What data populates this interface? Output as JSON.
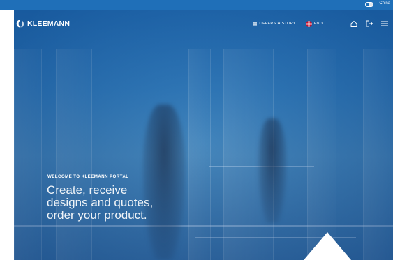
{
  "topbar": {
    "region_label": "China"
  },
  "header": {
    "brand": "KLEEMANN",
    "offers_history": "OFFERS HISTORY",
    "language": "EN",
    "icons": {
      "offers": "list-icon",
      "flag": "uk-flag-icon",
      "home": "home-icon",
      "logout": "logout-icon",
      "menu": "hamburger-menu-icon"
    }
  },
  "hero": {
    "welcome": "WELCOME TO KLEEMANN PORTAL",
    "headline": "Create, receive designs and quotes, order your product."
  },
  "colors": {
    "brand_blue": "#1f6fb8",
    "text": "#ffffff"
  }
}
